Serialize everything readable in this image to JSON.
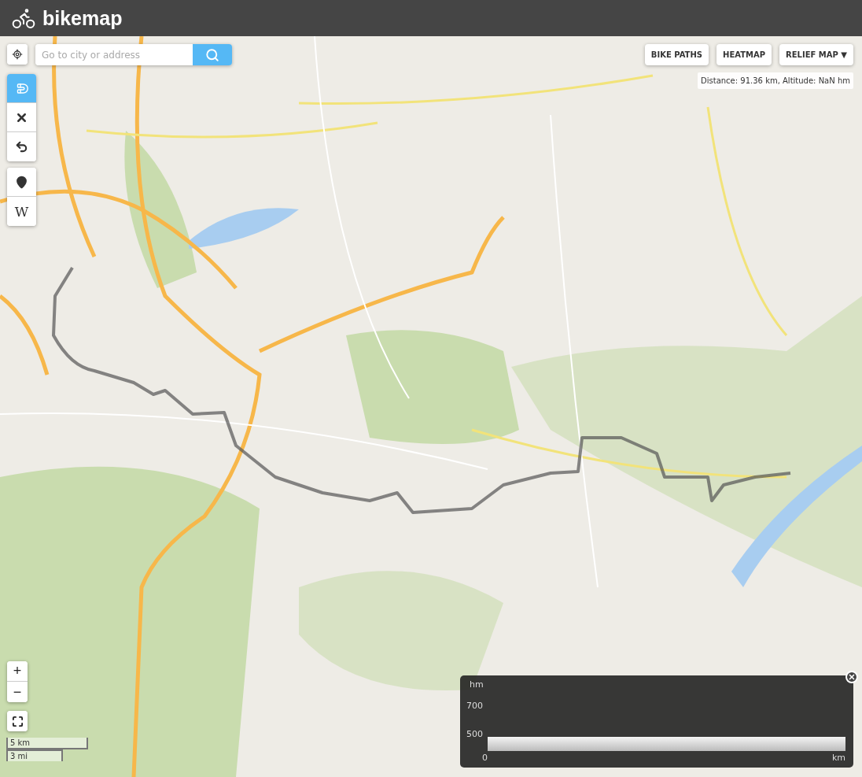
{
  "header": {
    "logo": "bikemap"
  },
  "search": {
    "placeholder": "Go to city or address"
  },
  "route_tools": [
    {
      "kind": "magnet",
      "selected": true
    },
    {
      "kind": "clear",
      "selected": false
    },
    {
      "kind": "undo",
      "selected": false
    }
  ],
  "layer_tools": [
    {
      "kind": "marker"
    },
    {
      "kind": "wiki",
      "label": "W"
    }
  ],
  "zoom": {
    "in": "+",
    "out": "−"
  },
  "scale": {
    "metric": "5 km",
    "imperial": "3 mi"
  },
  "layer_buttons": [
    {
      "label": "BIKE PATHS"
    },
    {
      "label": "HEATMAP"
    },
    {
      "label": "RELIEF MAP ▼"
    }
  ],
  "route_info": "Distance: 91.36 km, Altitude: NaN hm",
  "elevation_panel": {
    "y_unit": "hm",
    "y_labels": [
      "700",
      "500"
    ],
    "x_start": "0",
    "x_unit": "km"
  }
}
